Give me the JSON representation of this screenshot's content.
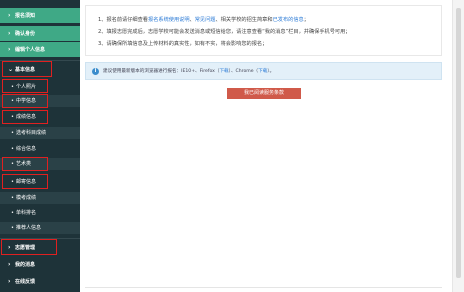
{
  "sidebar": {
    "top_items": [
      {
        "label": "报名须知"
      },
      {
        "label": "确认身份"
      },
      {
        "label": "编辑个人信息"
      }
    ],
    "basic_info": {
      "label": "基本信息",
      "items": [
        {
          "label": "个人照片"
        },
        {
          "label": "中学信息"
        },
        {
          "label": "成绩信息"
        },
        {
          "label": "选考科目成绩"
        },
        {
          "label": "综合信息"
        },
        {
          "label": "艺术类"
        },
        {
          "label": "邮寄信息"
        },
        {
          "label": "模考成绩"
        },
        {
          "label": "单科排名"
        },
        {
          "label": "推荐人信息"
        }
      ]
    },
    "bottom_items": [
      {
        "label": "志愿管理"
      },
      {
        "label": "我的消息"
      },
      {
        "label": "在线反馈"
      }
    ]
  },
  "notice": {
    "line1": {
      "prefix": "1、报名前请仔细查看",
      "link1": "报名系统使用说明",
      "sep1": "、",
      "link2": "常见问题",
      "mid": "、相关学校的招生简章和",
      "link3": "已发布的信息",
      "suffix": "；"
    },
    "line2": "2、填报志愿完成后，志愿学校可能会发送消息或短信给您，请注意查看“我的消息”栏目，并确保手机号可用；",
    "line3": "3、请确保所填信息及上传材料的真实性，如有不实，将会影响您的报名；"
  },
  "tip": {
    "prefix": "建议使用最新版本的浏览器进行报名：IE10+、Firefox（",
    "link1": "下载",
    "mid": "）、Chrome（",
    "link2": "下载",
    "suffix": "）。"
  },
  "agree_button": {
    "label": "我已阅读服务条款"
  },
  "colors": {
    "sidebar_bg": "#1e3339",
    "active": "#3fa986",
    "highlight": "#e02020",
    "link": "#2c7bd6",
    "button": "#d05a4a"
  }
}
